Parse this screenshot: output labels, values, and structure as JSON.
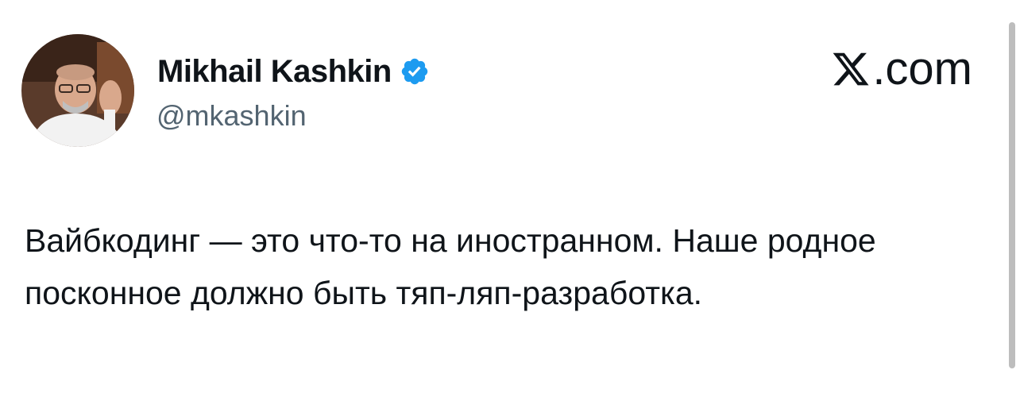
{
  "author": {
    "display_name": "Mikhail Kashkin",
    "handle": "@mkashkin",
    "verified": true,
    "verified_color": "#1d9bf0"
  },
  "brand": {
    "suffix": ".com",
    "icon": "x-logo-icon"
  },
  "tweet": {
    "text": "Вайбкодинг — это что-то на иностранном. Наше родное посконное должно быть тяп-ляп-разработка."
  },
  "colors": {
    "text": "#0f1419",
    "secondary_text": "#536471",
    "scrollbar": "#bdbdbd"
  }
}
